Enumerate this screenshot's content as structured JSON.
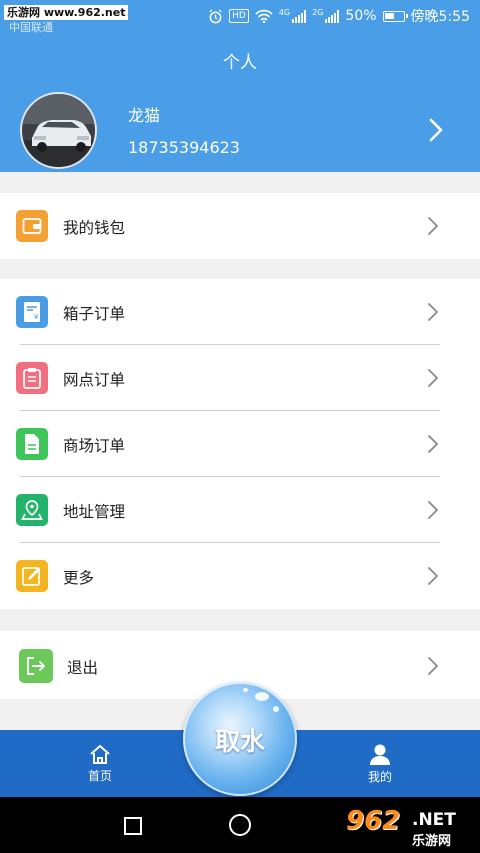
{
  "status_bar": {
    "watermark": "乐游网 www.962.net",
    "carrier": "中国联通",
    "hd": "HD",
    "net_4g": "4G",
    "net_2g": "2G",
    "battery": "50%",
    "time": "傍晚5:55"
  },
  "header": {
    "title": "个人",
    "user_name": "龙猫",
    "user_phone": "18735394623"
  },
  "menu_wallet": {
    "label": "我的钱包"
  },
  "menu_main": [
    {
      "label": "箱子订单"
    },
    {
      "label": "网点订单"
    },
    {
      "label": "商场订单"
    },
    {
      "label": "地址管理"
    },
    {
      "label": "更多"
    }
  ],
  "menu_logout": {
    "label": "退出"
  },
  "tabbar": {
    "home_label": "首页",
    "center_label": "取水",
    "mine_label": "我的"
  },
  "logo": {
    "number": "962",
    "net": ".NET",
    "cn": "乐游网"
  },
  "colors": {
    "header_bg": "#4a9ee8",
    "tabbar_bg": "#1f6bc6",
    "wallet_icon": "#f4a133",
    "box_icon": "#4a9de5",
    "outlet_icon": "#f36f7f",
    "mall_icon": "#3ec55a",
    "address_icon": "#24b36b",
    "more_icon": "#f3b621",
    "logout_icon": "#6dc85a"
  }
}
